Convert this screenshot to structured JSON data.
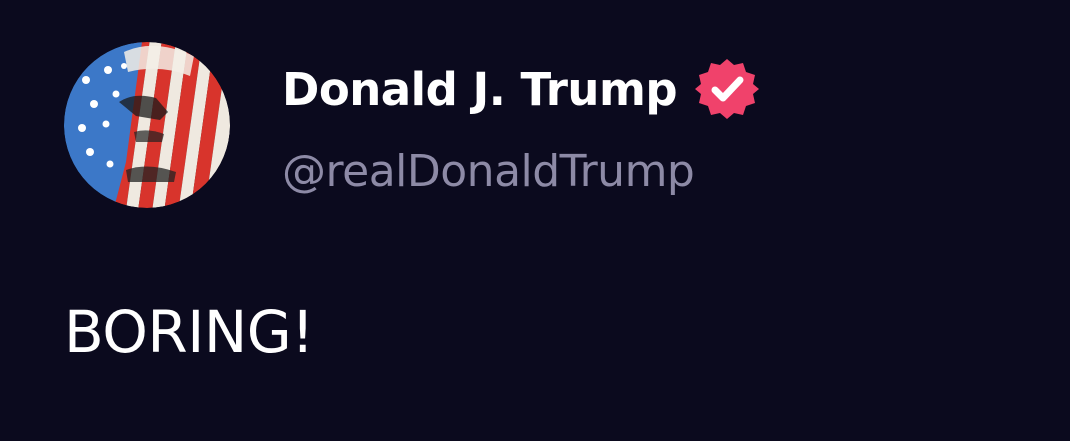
{
  "post": {
    "author": {
      "display_name": "Donald J. Trump",
      "handle": "@realDonaldTrump",
      "avatar_icon": "flag-portrait-avatar",
      "verified_icon": "verified-badge-icon",
      "verified": true
    },
    "text": "BORING!"
  },
  "colors": {
    "background": "#0b0a1e",
    "name": "#ffffff",
    "handle": "#8d8aa6",
    "verified_badge": "#f0426b",
    "text": "#ffffff"
  }
}
